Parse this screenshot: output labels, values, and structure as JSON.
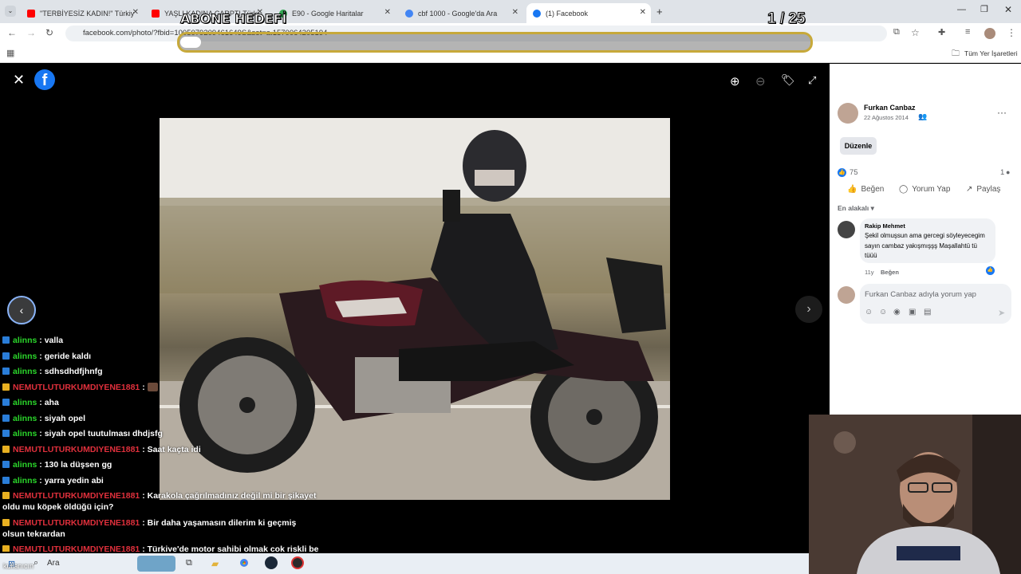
{
  "browser": {
    "tabs": [
      {
        "title": "\"TERBİYESİZ KADIN!\" Türkiye'de",
        "color": "#ff0000"
      },
      {
        "title": "YAŞLI KADINA ÇARPTI Türkiye",
        "color": "#ff0000"
      },
      {
        "title": "E90 - Google Haritalar",
        "color": "#34a853"
      },
      {
        "title": "cbf 1000 - Google'da Ara",
        "color": "#4285f4"
      },
      {
        "title": "(1) Facebook",
        "color": "#1877f2"
      }
    ],
    "url": "facebook.com/photo/?fbid=1005079209461649S&set=a.1570064205194",
    "bookmarks_label": "Tüm Yer İşaretleri"
  },
  "stream_overlay": {
    "goal_label": "ABONE HEDEFİ",
    "counter": "1  / 25"
  },
  "post": {
    "author": "Furkan Canbaz",
    "date": "22 Ağustos 2014",
    "edit_label": "Düzenle",
    "likes": "75",
    "comments_count": "1",
    "actions": {
      "like": "Beğen",
      "comment": "Yorum Yap",
      "share": "Paylaş"
    },
    "sort_label": "En alakalı",
    "comment": {
      "author": "Rakip Mehmet",
      "text": "Şekil olmuşsun ama gercegi söyleyecegim sayın cambaz yakışmışşş Maşallahtü tü tüüü",
      "age": "11y",
      "like_label": "Beğen"
    },
    "comment_placeholder": "Furkan Canbaz adıyla yorum yap",
    "notification_count": "1"
  },
  "chat": [
    {
      "user": "alinns",
      "text": "valla",
      "color": "#2bd62b",
      "badge": "#2a7dd8"
    },
    {
      "user": "alinns",
      "text": "geride kaldı",
      "color": "#2bd62b",
      "badge": "#2a7dd8"
    },
    {
      "user": "alinns",
      "text": "sdhsdhdfjhnfg",
      "color": "#2bd62b",
      "badge": "#2a7dd8"
    },
    {
      "user": "NEMUTLUTURKUMDIYENE1881",
      "text": "",
      "color": "#e0303c",
      "badge": "#e8b021"
    },
    {
      "user": "alinns",
      "text": "aha",
      "color": "#2bd62b",
      "badge": "#2a7dd8"
    },
    {
      "user": "alinns",
      "text": "siyah opel",
      "color": "#2bd62b",
      "badge": "#2a7dd8"
    },
    {
      "user": "alinns",
      "text": "siyah opel tuutulması dhdjsfg",
      "color": "#2bd62b",
      "badge": "#2a7dd8"
    },
    {
      "user": "NEMUTLUTURKUMDIYENE1881",
      "text": "Saat kaçta idi",
      "color": "#e0303c",
      "badge": "#e8b021"
    },
    {
      "user": "alinns",
      "text": "130 la düşsen gg",
      "color": "#2bd62b",
      "badge": "#2a7dd8"
    },
    {
      "user": "alinns",
      "text": "yarra yedin abi",
      "color": "#2bd62b",
      "badge": "#2a7dd8"
    },
    {
      "user": "NEMUTLUTURKUMDIYENE1881",
      "text": "Karakola çağrılmadınız değil mi bir şikayet oldu mu köpek öldüğü için?",
      "color": "#e0303c",
      "badge": "#e8b021"
    },
    {
      "user": "NEMUTLUTURKUMDIYENE1881",
      "text": "Bir daha yaşamasın dilerim ki geçmiş olsun tekrardan",
      "color": "#e0303c",
      "badge": "#e8b021"
    },
    {
      "user": "NEMUTLUTURKUMDIYENE1881",
      "text": "Türkiye'de motor sahibi olmak çok riskli ben",
      "color": "#e0303c",
      "badge": "#e8b021"
    }
  ],
  "taskbar": {
    "search_label": "Ara",
    "user_label": "kullanıcın"
  },
  "icons": [
    "close-icon",
    "facebook-logo-icon",
    "zoom-in-icon",
    "zoom-out-icon",
    "tag-icon",
    "fullscreen-icon",
    "prev-arrow-icon",
    "next-arrow-icon",
    "grid-icon",
    "messenger-icon",
    "bell-icon",
    "like-icon",
    "comment-icon",
    "share-icon",
    "more-icon"
  ]
}
